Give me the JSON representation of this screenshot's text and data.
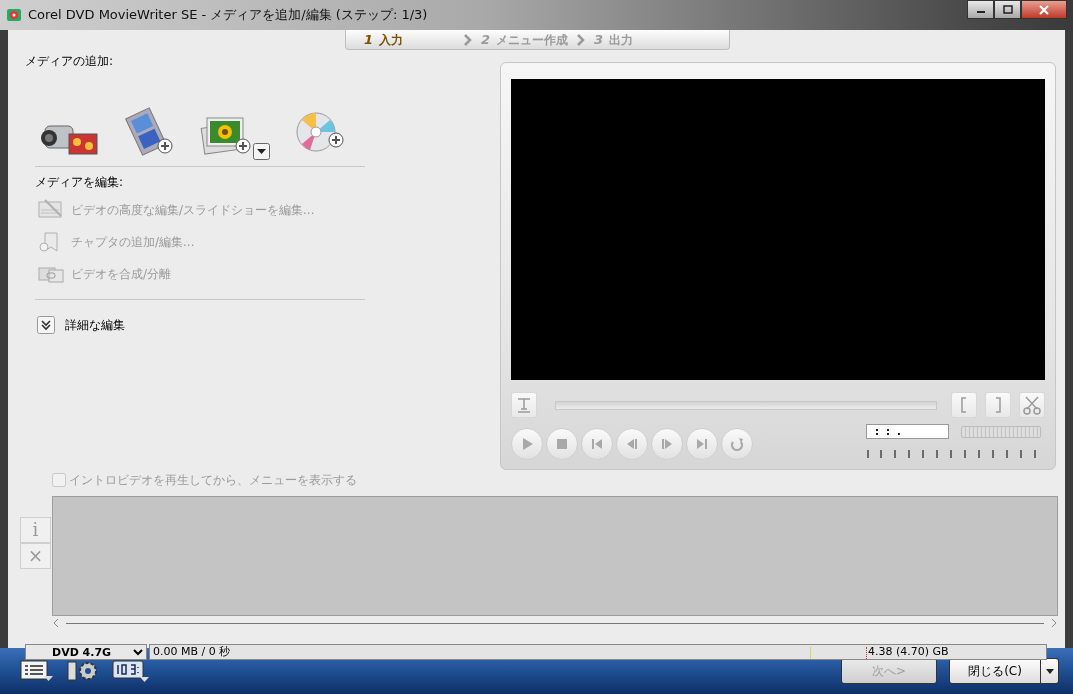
{
  "window": {
    "title": "Corel DVD MovieWriter SE - メディアを追加/編集 (ステップ: 1/3)"
  },
  "steps": [
    {
      "number": "1",
      "label": "入力",
      "selected": true
    },
    {
      "number": "2",
      "label": "メニュー作成",
      "selected": false
    },
    {
      "number": "3",
      "label": "出力",
      "selected": false
    }
  ],
  "add_media": {
    "label": "メディアの追加:"
  },
  "edit_media": {
    "label": "メディアを編集:",
    "items": [
      {
        "label": "ビデオの高度な編集/スライドショーを編集...",
        "disabled": true
      },
      {
        "label": "チャプタの追加/編集...",
        "disabled": true
      },
      {
        "label": "ビデオを合成/分離",
        "disabled": true
      }
    ]
  },
  "advanced": {
    "label": "詳細な編集",
    "expanded": false
  },
  "player": {
    "time_display": ":  :  ."
  },
  "intro_option": {
    "label": "イントロビデオを再生してから、メニューを表示する",
    "checked": false,
    "disabled": true
  },
  "side_buttons": [
    "i",
    "×"
  ],
  "disc": {
    "type": "DVD 4.7G",
    "usage": "0.00 MB / 0 秒",
    "capacity": "4.38 (4.70) GB"
  },
  "footer": {
    "next": {
      "label": "次へ>",
      "disabled": true
    },
    "close": {
      "label": "閉じる(C)",
      "disabled": false
    }
  }
}
